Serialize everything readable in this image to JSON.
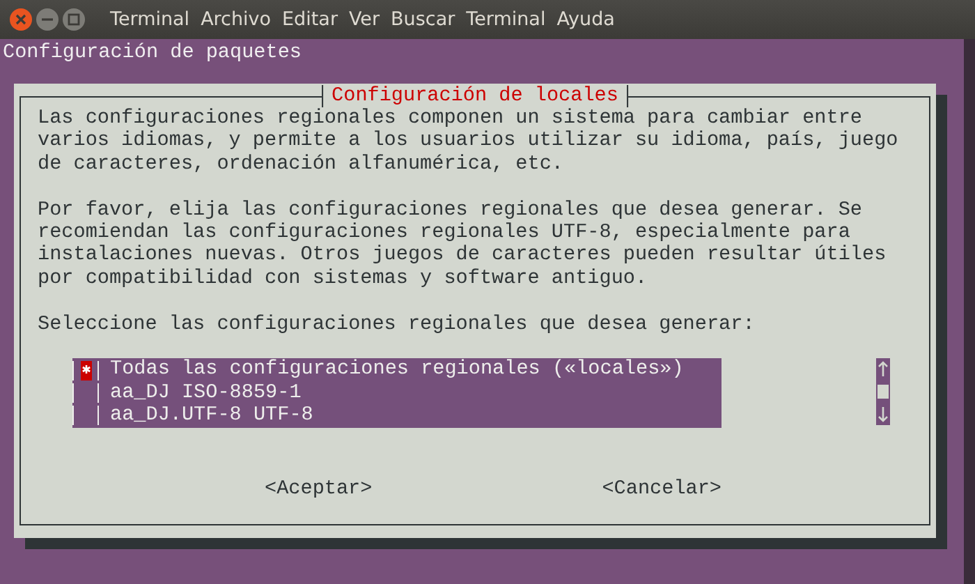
{
  "menu": [
    "Terminal",
    "Archivo",
    "Editar",
    "Ver",
    "Buscar",
    "Terminal",
    "Ayuda"
  ],
  "terminal": {
    "header": "Configuración de paquetes"
  },
  "dialog": {
    "title": "Configuración de locales",
    "paragraphs": [
      "Las configuraciones regionales componen un sistema para cambiar entre varios idiomas, y permite a los usuarios utilizar su idioma, país, juego de caracteres, ordenación alfanumérica, etc.",
      "Por favor, elija las configuraciones regionales que desea generar. Se recomiendan las configuraciones regionales UTF-8, especialmente para instalaciones nuevas. Otros juegos de caracteres pueden resultar útiles por compatibilidad con sistemas y software antiguo.",
      "Seleccione las configuraciones regionales que desea generar:"
    ],
    "items": [
      {
        "label": "Todas las configuraciones regionales («locales»)",
        "checked": true
      },
      {
        "label": "aa_DJ ISO-8859-1",
        "checked": false
      },
      {
        "label": "aa_DJ.UTF-8 UTF-8",
        "checked": false
      }
    ],
    "buttons": [
      "<Aceptar>",
      "<Cancelar>"
    ]
  }
}
